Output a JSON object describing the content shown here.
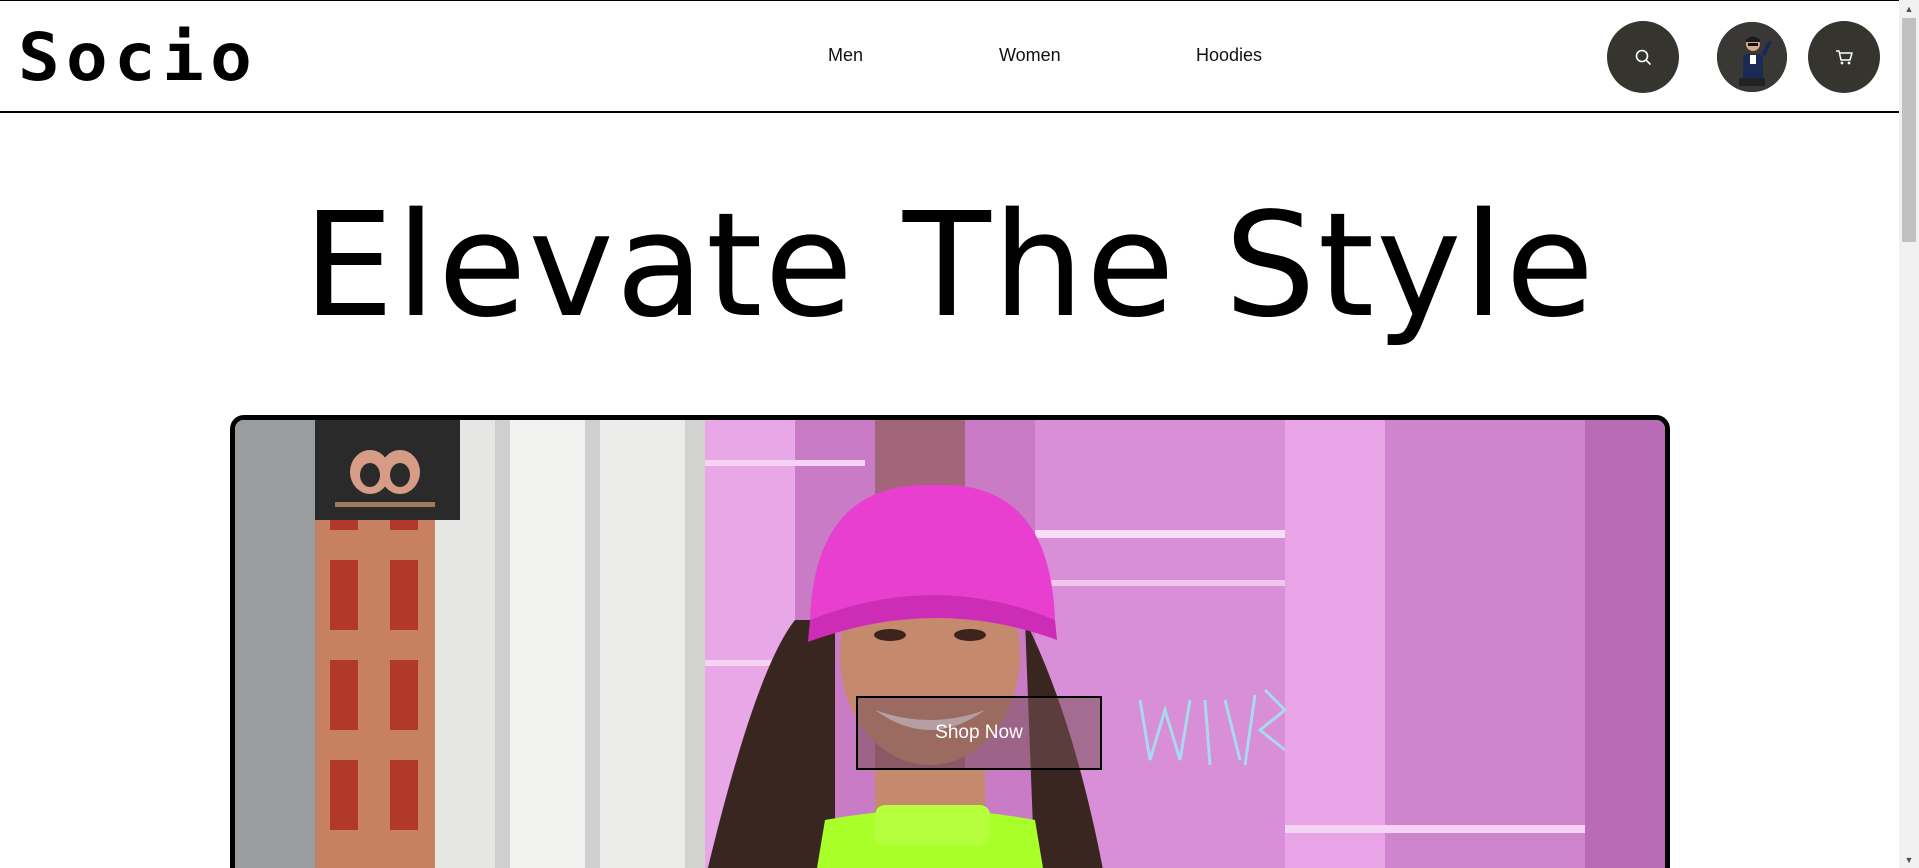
{
  "header": {
    "logo": "Socio",
    "nav": [
      {
        "label": "Men"
      },
      {
        "label": "Women"
      },
      {
        "label": "Hoodies"
      }
    ],
    "icons": {
      "search": "search-icon",
      "avatar": "avatar",
      "cart": "cart-icon"
    }
  },
  "hero": {
    "title": "Elevate The Style",
    "cta_label": "Shop Now",
    "image": "hero-photo-woman-pink-beanie"
  },
  "colors": {
    "text": "#000000",
    "icon_button_bg": "#35342f",
    "hero_pink": "#e29ae0",
    "beanie_pink": "#e83fd0",
    "neon_green": "#a8ff2a"
  }
}
